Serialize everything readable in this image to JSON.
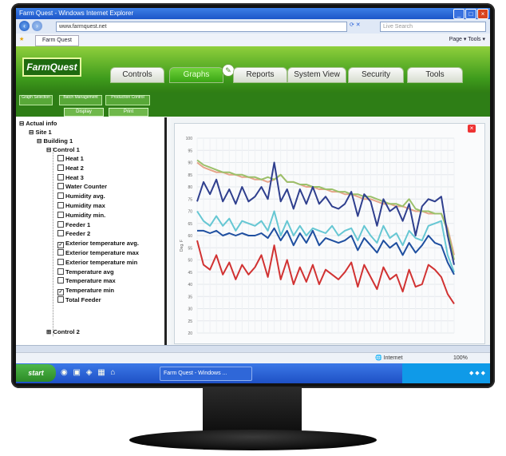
{
  "browser": {
    "title": "Farm Quest - Windows Internet Explorer",
    "url": "www.farmquest.net",
    "search_placeholder": "Live Search",
    "tab": "Farm Quest",
    "commands": "Page ▾  Tools ▾"
  },
  "app": {
    "logo": "FarmQuest",
    "tabs": [
      "Controls",
      "Graphs",
      "Reports",
      "System View",
      "Security",
      "Tools"
    ],
    "active_tab": "Graphs",
    "subnav": [
      "Graph Selection",
      "Batch Management",
      "Production Control"
    ],
    "subbuttons": [
      "Display",
      "Print"
    ]
  },
  "tree": {
    "root": "Actual info",
    "site": "Site 1",
    "building": "Building 1",
    "control1": "Control 1",
    "control2": "Control 2",
    "items": [
      {
        "label": "Heat 1",
        "checked": false
      },
      {
        "label": "Heat 2",
        "checked": false
      },
      {
        "label": "Heat 3",
        "checked": false
      },
      {
        "label": "Water Counter",
        "checked": false
      },
      {
        "label": "Humidity avg.",
        "checked": false
      },
      {
        "label": "Humidity max",
        "checked": false
      },
      {
        "label": "Humidity min.",
        "checked": false
      },
      {
        "label": "Feeder 1",
        "checked": false
      },
      {
        "label": "Feeder 2",
        "checked": false
      },
      {
        "label": "Exterior temperature avg.",
        "checked": true
      },
      {
        "label": "Exterior temperature max",
        "checked": false
      },
      {
        "label": "Exterior temperature min",
        "checked": false
      },
      {
        "label": "Temperature avg",
        "checked": false
      },
      {
        "label": "Temperature max",
        "checked": false
      },
      {
        "label": "Temperature min",
        "checked": true
      },
      {
        "label": "Total Feeder",
        "checked": false
      }
    ]
  },
  "chart_data": {
    "type": "line",
    "ylabel": "Deg. F",
    "ylim": [
      20,
      100
    ],
    "yticks": [
      "100",
      "95",
      "90",
      "85",
      "80",
      "75",
      "70",
      "65",
      "60",
      "55",
      "50",
      "45",
      "40",
      "35",
      "30",
      "25",
      "20"
    ],
    "x": [
      0,
      1,
      2,
      3,
      4,
      5,
      6,
      7,
      8,
      9,
      10,
      11,
      12,
      13,
      14,
      15,
      16,
      17,
      18,
      19,
      20,
      21,
      22,
      23,
      24,
      25,
      26,
      27,
      28,
      29,
      30,
      31,
      32,
      33,
      34,
      35,
      36,
      37,
      38,
      39,
      40
    ],
    "series": [
      {
        "color": "#e6a48a",
        "values": [
          90,
          88,
          87,
          86,
          86,
          85,
          85,
          84,
          84,
          83,
          83,
          82,
          83,
          85,
          82,
          82,
          81,
          80,
          80,
          79,
          79,
          78,
          78,
          77,
          77,
          76,
          75,
          75,
          74,
          73,
          73,
          72,
          72,
          71,
          70,
          70,
          69,
          69,
          69,
          63,
          52
        ]
      },
      {
        "color": "#9bc06a",
        "values": [
          91,
          89,
          88,
          87,
          86,
          86,
          85,
          85,
          84,
          84,
          83,
          84,
          83,
          85,
          82,
          82,
          81,
          81,
          80,
          80,
          79,
          79,
          78,
          78,
          77,
          77,
          76,
          76,
          75,
          74,
          73,
          73,
          72,
          75,
          71,
          70,
          70,
          69,
          69,
          62,
          50
        ]
      },
      {
        "color": "#2f3f8e",
        "values": [
          74,
          82,
          77,
          83,
          74,
          79,
          73,
          80,
          74,
          76,
          80,
          75,
          90,
          74,
          79,
          71,
          79,
          73,
          80,
          73,
          76,
          72,
          71,
          73,
          78,
          68,
          77,
          74,
          64,
          75,
          70,
          72,
          66,
          73,
          60,
          72,
          75,
          74,
          76,
          60,
          48
        ]
      },
      {
        "color": "#66c7d3",
        "values": [
          70,
          66,
          64,
          68,
          64,
          67,
          62,
          66,
          65,
          64,
          66,
          62,
          70,
          60,
          66,
          60,
          64,
          60,
          63,
          62,
          61,
          64,
          60,
          62,
          63,
          58,
          64,
          60,
          57,
          64,
          59,
          61,
          56,
          62,
          59,
          58,
          64,
          65,
          66,
          52,
          45
        ]
      },
      {
        "color": "#1f4fa0",
        "values": [
          62,
          62,
          61,
          62,
          60,
          61,
          60,
          61,
          60,
          60,
          61,
          59,
          63,
          58,
          62,
          56,
          61,
          57,
          62,
          56,
          59,
          58,
          57,
          58,
          60,
          54,
          59,
          56,
          53,
          58,
          55,
          57,
          52,
          57,
          53,
          56,
          60,
          57,
          56,
          49,
          44
        ]
      },
      {
        "color": "#d13232",
        "values": [
          58,
          48,
          46,
          52,
          44,
          49,
          42,
          48,
          44,
          47,
          52,
          43,
          56,
          42,
          50,
          40,
          47,
          41,
          48,
          40,
          46,
          44,
          42,
          45,
          49,
          39,
          48,
          43,
          38,
          47,
          42,
          44,
          37,
          46,
          39,
          40,
          48,
          46,
          43,
          36,
          32
        ]
      }
    ]
  },
  "status": {
    "zone": "Internet",
    "zoom": "100%"
  },
  "taskbar": {
    "start": "start",
    "window": "Farm Quest - Windows ..."
  }
}
